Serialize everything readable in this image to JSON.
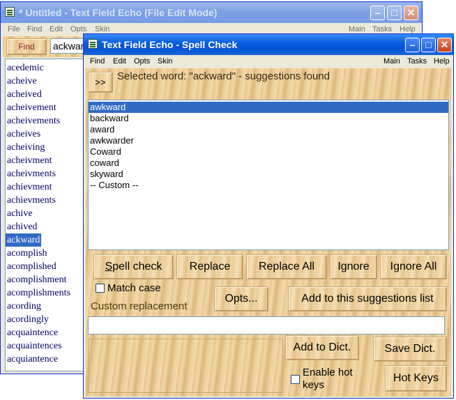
{
  "back_window": {
    "title": "* Untitled - Text Field Echo (File Edit Mode)",
    "menu_left": [
      "File",
      "Find",
      "Edit",
      "Opts",
      "Skin"
    ],
    "menu_right": [
      "Main",
      "Tasks",
      "Help"
    ],
    "find_button": "Find",
    "search_value": "ackwar",
    "words": [
      "acedemic",
      "acheive",
      "acheived",
      "acheivement",
      "acheivements",
      "acheives",
      "acheiving",
      "acheivment",
      "acheivments",
      "achievment",
      "achievments",
      "achive",
      "achived",
      "ackward",
      "acomplish",
      "acomplished",
      "acomplishment",
      "acomplishments",
      "acording",
      "acordingly",
      "acquaintence",
      "acquaintences",
      "acquiantence"
    ],
    "selected_word": "ackward"
  },
  "front_window": {
    "title": "Text Field Echo - Spell Check",
    "menu_left": [
      "Find",
      "Edit",
      "Opts",
      "Skin"
    ],
    "menu_right": [
      "Main",
      "Tasks",
      "Help"
    ],
    "expand_button": ">>",
    "status": "Selected word: \"ackward\" - suggestions found",
    "suggestions": [
      "awkward",
      "backward",
      "award",
      "awkwarder",
      "Coward",
      "coward",
      "skyward",
      "-- Custom --"
    ],
    "selected_suggestion": "awkward",
    "buttons": {
      "spell_check": "Spell check",
      "replace": "Replace",
      "replace_all": "Replace All",
      "ignore": "Ignore",
      "ignore_all": "Ignore All",
      "opts": "Opts...",
      "add_to_suggestions": "Add to this suggestions list",
      "add_to_dict": "Add to Dict.",
      "save_dict": "Save Dict.",
      "hot_keys": "Hot Keys"
    },
    "match_case_label": "Match case",
    "match_case_checked": false,
    "custom_replacement_label": "Custom replacement",
    "custom_replacement_value": "",
    "enable_hot_keys_label": "Enable hot keys",
    "enable_hot_keys_checked": false
  }
}
